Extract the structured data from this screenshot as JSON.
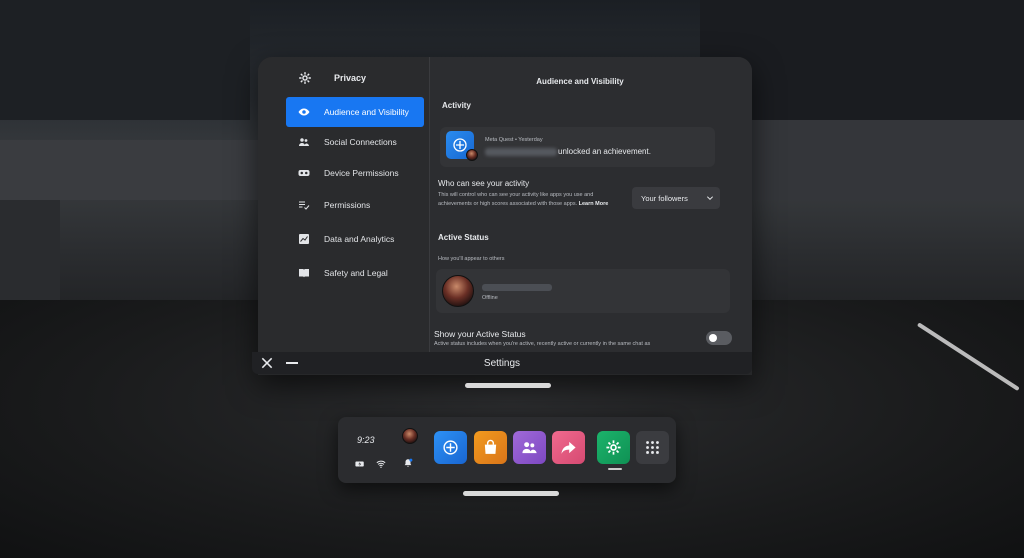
{
  "sidebar": {
    "title": "Privacy",
    "items": [
      {
        "label": "Audience and Visibility"
      },
      {
        "label": "Social Connections"
      },
      {
        "label": "Device Permissions"
      },
      {
        "label": "Permissions"
      },
      {
        "label": "Data and Analytics"
      },
      {
        "label": "Safety and Legal"
      }
    ]
  },
  "main": {
    "title": "Audience and Visibility",
    "activity": {
      "heading": "Activity",
      "card_meta": "Meta Quest • Yesterday",
      "card_text": "unlocked an achievement."
    },
    "who_can_see": {
      "title": "Who can see your activity",
      "description": "This will control who can see your activity like apps you use and achievements or high scores associated with those apps.",
      "learn_more": "Learn More",
      "dropdown_value": "Your followers"
    },
    "active_status": {
      "heading": "Active Status",
      "subheading": "How you'll appear to others",
      "status": "Offline",
      "show_title": "Show your Active Status",
      "show_description": "Active status includes when you're active, recently active or currently in the same chat as"
    }
  },
  "window": {
    "title": "Settings"
  },
  "dock": {
    "time": "9:23"
  },
  "colors": {
    "accent": "#1877f2",
    "panel": "#2c2d30"
  }
}
